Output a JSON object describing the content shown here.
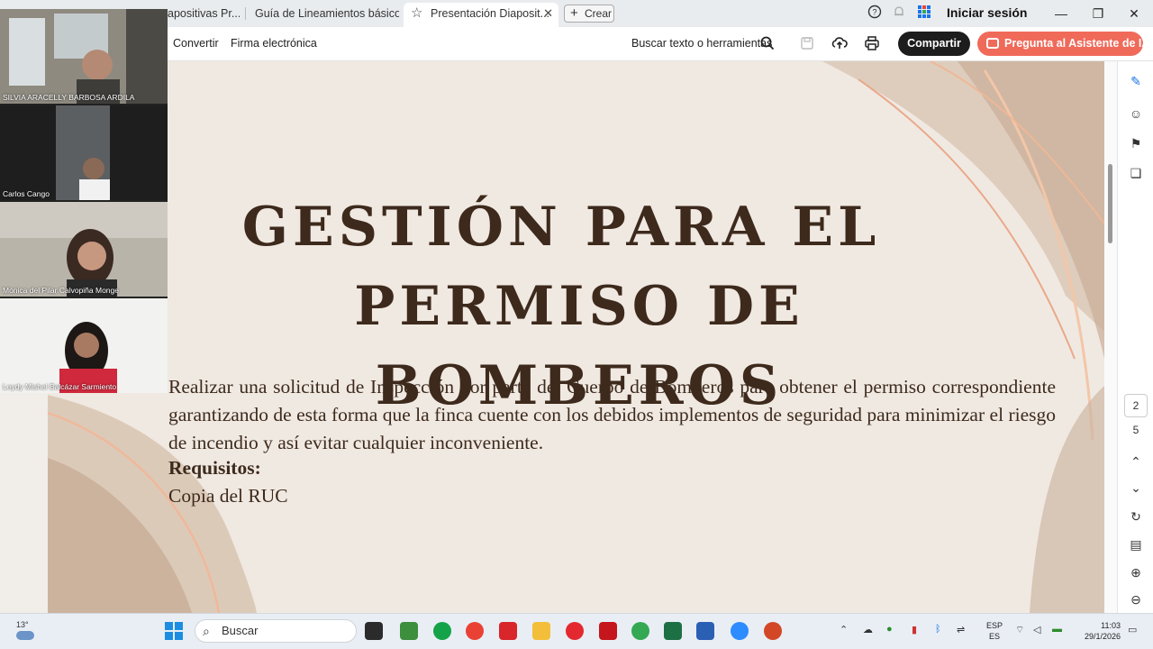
{
  "browser": {
    "tabs": [
      {
        "label": "apositivas Pr..."
      },
      {
        "label": "Guía de Lineamientos básico..."
      },
      {
        "label": "Presentación Diaposit..."
      }
    ],
    "new_tab_label": "Crear",
    "signin_label": "Iniciar sesión"
  },
  "toolbar": {
    "convert_label": "Convertir",
    "sign_label": "Firma electrónica",
    "search_tools_label": "Buscar texto o herramientas",
    "share_label": "Compartir",
    "ai_label": "Pregunta al Asistente de IA"
  },
  "participants": [
    {
      "name": "SILVIA ARACELLY BARBOSA ARDILA"
    },
    {
      "name": "Carlos Cango"
    },
    {
      "name": "Mónica del Pilar Calvopiña Monge"
    },
    {
      "name": "Leydy Mishel Balcázar Sarmiento"
    }
  ],
  "slide": {
    "title_line1": "GESTIÓN PARA EL",
    "title_line2": "PERMISO DE BOMBEROS",
    "body": "Realizar una solicitud de Inspección por parte del Cuerpo de Bomberos para obtener el permiso correspondiente garantizando de esta forma que la finca cuente con los debidos implementos de seguridad para minimizar el riesgo de incendio y así evitar cualquier inconveniente.",
    "requirements_heading": "Requisitos:",
    "requirement_1": "Copia del RUC"
  },
  "pagination": {
    "current": "2",
    "total": "5"
  },
  "taskbar": {
    "temperature": "13°",
    "search_placeholder": "Buscar",
    "lang_line1": "ESP",
    "lang_line2": "ES",
    "time": "11:03",
    "date": "29/1/2026"
  },
  "colors": {
    "slide_bg": "#f0e9e2",
    "title_text": "#3d2a1c",
    "ai_button": "#f06a5a",
    "share_button": "#1d1d1d"
  }
}
